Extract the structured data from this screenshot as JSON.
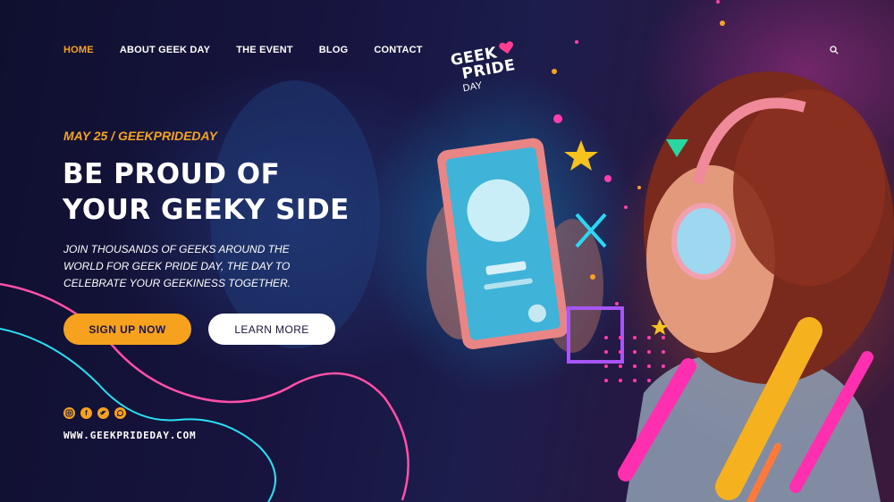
{
  "nav": {
    "items": [
      {
        "label": "HOME",
        "active": true
      },
      {
        "label": "ABOUT GEEK DAY",
        "active": false
      },
      {
        "label": "THE EVENT",
        "active": false
      },
      {
        "label": "BLOG",
        "active": false
      },
      {
        "label": "CONTACT",
        "active": false
      }
    ],
    "search_icon": "search-icon"
  },
  "logo": {
    "line1": "GEEK",
    "line2": "PRIDE",
    "line3": "DAY",
    "icon": "heart-icon"
  },
  "hero": {
    "date": "MAY 25 / GEEKPRIDEDAY",
    "headline_line1": "BE PROUD OF",
    "headline_line2": "YOUR GEEKY SIDE",
    "description": "JOIN THOUSANDS OF GEEKS AROUND THE WORLD FOR GEEK PRIDE DAY, THE DAY TO CELEBRATE YOUR GEEKINESS TOGETHER.",
    "primary_button": "SIGN UP NOW",
    "secondary_button": "LEARN MORE"
  },
  "social": [
    "instagram-icon",
    "facebook-icon",
    "twitter-icon",
    "whatsapp-icon"
  ],
  "footer": {
    "url": "WWW.GEEKPRIDEDAY.COM"
  },
  "colors": {
    "accent": "#f6a21e",
    "background": "#17143f",
    "text": "#ffffff"
  }
}
